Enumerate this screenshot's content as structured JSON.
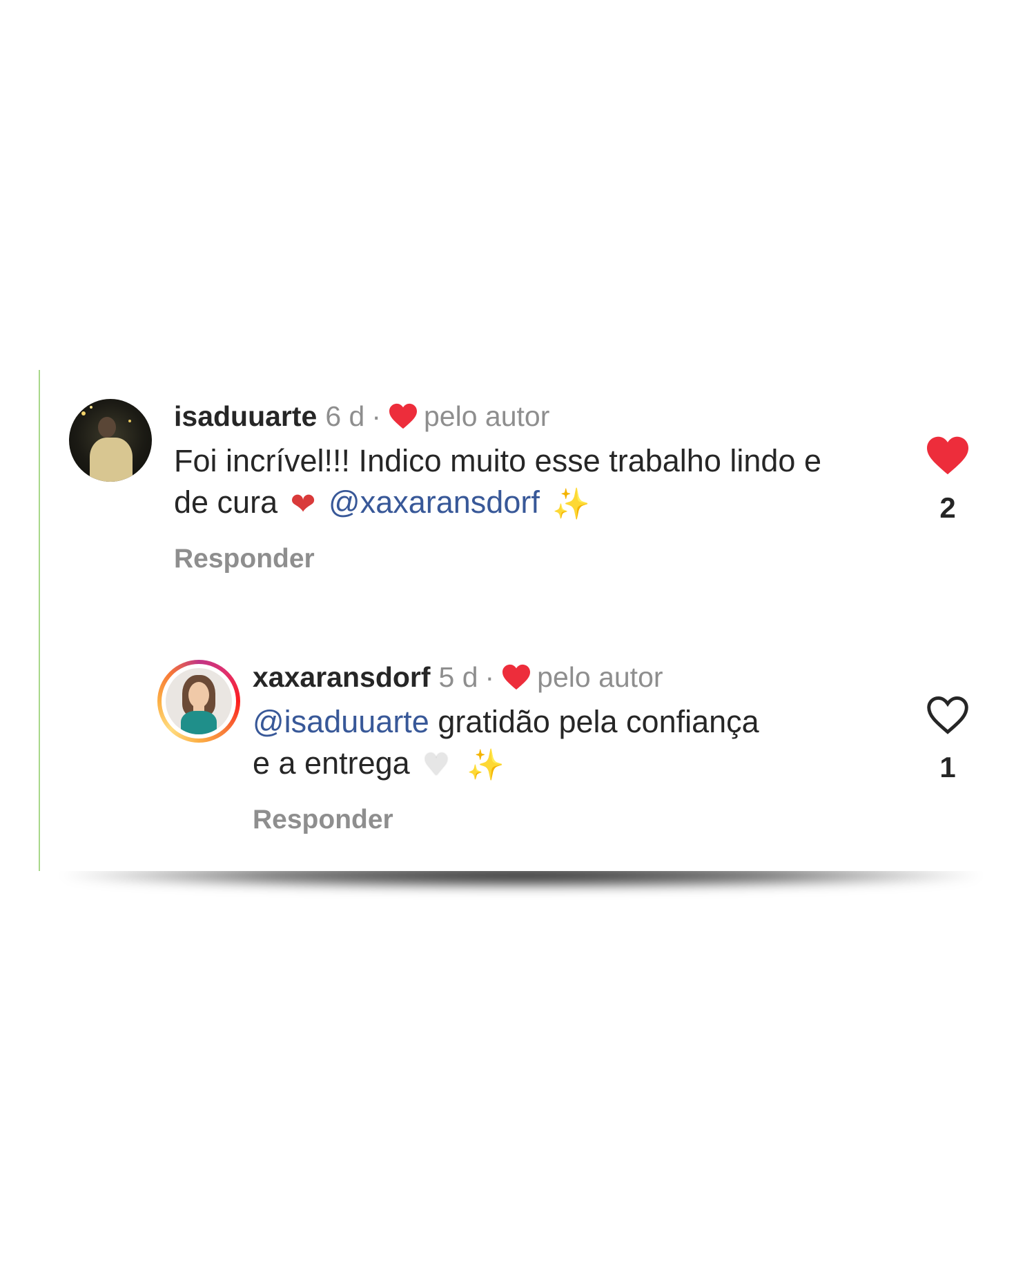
{
  "comments": [
    {
      "username": "isaduuarte",
      "time": "6 d",
      "separator": "·",
      "author_badge": "pelo autor",
      "text_part1": "Foi incrível!!! Indico muito esse trabalho lindo e de cura",
      "emoji_heart": "❤",
      "mention": "@xaxaransdorf",
      "emoji_sparkles": "✨",
      "reply_label": "Responder",
      "like_count": "2",
      "liked": true,
      "avatar_icon": "profile-photo-dark"
    },
    {
      "username": "xaxaransdorf",
      "time": "5 d",
      "separator": "·",
      "author_badge": "pelo autor",
      "mention": "@isaduuarte",
      "text_part1": "gratidão pela confiança e a entrega",
      "emoji_heart": "♥",
      "emoji_sparkles": "✨",
      "reply_label": "Responder",
      "like_count": "1",
      "liked": false,
      "avatar_icon": "profile-photo-story-ring"
    }
  ],
  "colors": {
    "liked_heart": "#ed2d3b",
    "mention": "#385898",
    "muted": "#8e8e8e",
    "text": "#262626"
  }
}
